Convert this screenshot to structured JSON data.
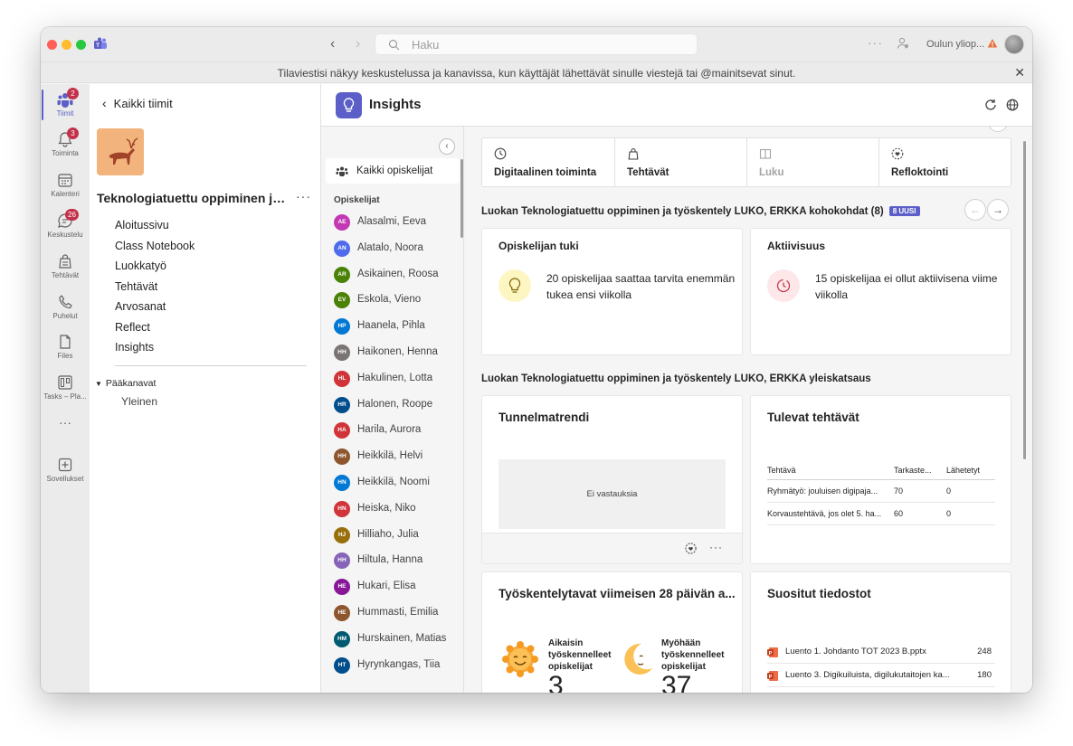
{
  "titlebar": {
    "search_placeholder": "Haku",
    "org_name": "Oulun yliop...",
    "more": "···"
  },
  "banner": {
    "text": "Tilaviestisi näkyy keskustelussa ja kanavissa, kun käyttäjät lähettävät sinulle viestejä tai @mainitsevat sinut."
  },
  "rail": {
    "items": [
      {
        "label": "Tiimit",
        "badge": "2",
        "icon": "teams-icon"
      },
      {
        "label": "Toiminta",
        "badge": "3",
        "icon": "bell-icon"
      },
      {
        "label": "Kalenteri",
        "badge": "",
        "icon": "calendar-icon"
      },
      {
        "label": "Keskustelu",
        "badge": "26",
        "icon": "chat-icon"
      },
      {
        "label": "Tehtävät",
        "badge": "",
        "icon": "assignments-icon"
      },
      {
        "label": "Puhelut",
        "badge": "",
        "icon": "phone-icon"
      },
      {
        "label": "Files",
        "badge": "",
        "icon": "file-icon"
      },
      {
        "label": "Tasks – Pla...",
        "badge": "",
        "icon": "planner-icon"
      },
      {
        "label": "Sovellukset",
        "badge": "",
        "icon": "add-apps-icon"
      }
    ],
    "more": "···"
  },
  "team": {
    "back_label": "Kaikki tiimit",
    "name": "Teknologiatuettu oppiminen ja t...",
    "more": "···",
    "nav": [
      "Aloitussivu",
      "Class Notebook",
      "Luokkatyö",
      "Tehtävät",
      "Arvosanat",
      "Reflect",
      "Insights"
    ],
    "channels_heading": "Pääkanavat",
    "channels": [
      "Yleinen"
    ]
  },
  "insights": {
    "title": "Insights",
    "all_students": "Kaikki opiskelijat",
    "students_heading": "Opiskelijat",
    "students": [
      {
        "initials": "AE",
        "name": "Alasalmi, Eeva",
        "color": "#c239b3"
      },
      {
        "initials": "AN",
        "name": "Alatalo, Noora",
        "color": "#4f6bed"
      },
      {
        "initials": "AR",
        "name": "Asikainen, Roosa",
        "color": "#498205"
      },
      {
        "initials": "EV",
        "name": "Eskola, Vieno",
        "color": "#498205"
      },
      {
        "initials": "HP",
        "name": "Haanela, Pihla",
        "color": "#0078d4"
      },
      {
        "initials": "HH",
        "name": "Haikonen, Henna",
        "color": "#7a7574"
      },
      {
        "initials": "HL",
        "name": "Hakulinen, Lotta",
        "color": "#d13438"
      },
      {
        "initials": "HR",
        "name": "Halonen, Roope",
        "color": "#004e8c"
      },
      {
        "initials": "HA",
        "name": "Harila, Aurora",
        "color": "#d13438"
      },
      {
        "initials": "HH",
        "name": "Heikkilä, Helvi",
        "color": "#8e562e"
      },
      {
        "initials": "HN",
        "name": "Heikkilä, Noomi",
        "color": "#0078d4"
      },
      {
        "initials": "HN",
        "name": "Heiska, Niko",
        "color": "#d13438"
      },
      {
        "initials": "HJ",
        "name": "Hilliaho, Julia",
        "color": "#986f0b"
      },
      {
        "initials": "HH",
        "name": "Hiltula, Hanna",
        "color": "#8764b8"
      },
      {
        "initials": "HE",
        "name": "Hukari, Elisa",
        "color": "#881798"
      },
      {
        "initials": "HE",
        "name": "Hummasti, Emilia",
        "color": "#8e562e"
      },
      {
        "initials": "HM",
        "name": "Hurskainen, Matias",
        "color": "#005b70"
      },
      {
        "initials": "HT",
        "name": "Hyrynkangas, Tiia",
        "color": "#004e8c"
      }
    ],
    "tabs": [
      {
        "label": "Digitaalinen toiminta",
        "icon": "clock-icon"
      },
      {
        "label": "Tehtävät",
        "icon": "assignments-icon"
      },
      {
        "label": "Luku",
        "icon": "book-icon"
      },
      {
        "label": "Refloktointi",
        "icon": "reflect-icon"
      }
    ],
    "highlights_title": "Luokan Teknologiatuettu oppiminen ja työskentely LUKO, ERKKA kohokohdat (8)",
    "highlights_badge": "8 UUSI",
    "highlights": [
      {
        "title": "Opiskelijan tuki",
        "text": "20 opiskelijaa saattaa tarvita enemmän tukea ensi viikolla"
      },
      {
        "title": "Aktiivisuus",
        "text": "15 opiskelijaa ei ollut aktiivisena viime viikolla"
      }
    ],
    "overview_title": "Luokan Teknologiatuettu oppiminen ja työskentely LUKO, ERKKA yleiskatsaus",
    "mood": {
      "title": "Tunnelmatrendi",
      "empty": "Ei vastauksia",
      "more": "···"
    },
    "upcoming": {
      "title": "Tulevat tehtävät",
      "headers": [
        "Tehtävä",
        "Tarkaste...",
        "Lähetetyt"
      ],
      "rows": [
        [
          "Ryhmätyö: jouluisen digipaja...",
          "70",
          "0"
        ],
        [
          "Korvaustehtävä, jos olet 5. ha...",
          "60",
          "0"
        ]
      ]
    },
    "work_patterns": {
      "title": "Työskentelytavat viimeisen 28 päivän a...",
      "early_label": "Aikaisin työskennelleet opiskelijat",
      "early_value": "3",
      "late_label": "Myöhään työskennelleet opiskelijat",
      "late_value": "37"
    },
    "popular_files": {
      "title": "Suositut tiedostot",
      "files": [
        {
          "name": "Luento 1. Johdanto TOT 2023 B.pptx",
          "value": "248"
        },
        {
          "name": "Luento 3. Digikuiluista, digilukutaitojen ka...",
          "value": "180"
        }
      ]
    }
  }
}
